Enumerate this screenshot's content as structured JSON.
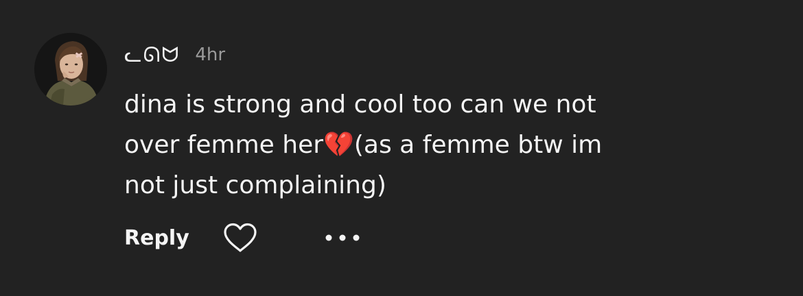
{
  "comment": {
    "username": "ᓚᘏᗢ",
    "timestamp": "4hr",
    "text": "dina is strong and cool too can we not\nover femme her💔(as a femme btw im\nnot just complaining)",
    "avatar_icon": "user-avatar-portrait"
  },
  "actions": {
    "reply_label": "Reply",
    "like_icon": "heart-outline-icon",
    "more_icon": "more-dots-icon"
  },
  "colors": {
    "background": "#222222",
    "text": "#f5f5f5",
    "muted": "#9a9a9a"
  }
}
